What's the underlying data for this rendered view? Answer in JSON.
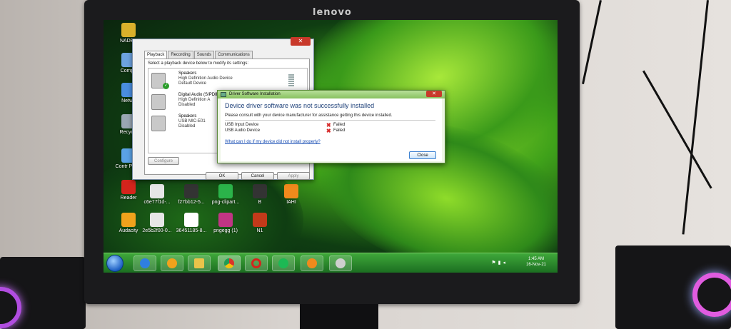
{
  "monitor": {
    "brand": "lenovo"
  },
  "desktop": {
    "icons": [
      {
        "label": "NADEE",
        "color": "#d9b12b"
      },
      {
        "label": "Compu",
        "color": "#6da3e0"
      },
      {
        "label": "Netwo",
        "color": "#4a8ee0"
      },
      {
        "label": "Recycle",
        "color": "#9aa7b3"
      },
      {
        "label": "Contr Panel",
        "color": "#5aa2e6"
      },
      {
        "label": "Reader",
        "color": "#d4241c"
      },
      {
        "label": "Audacity",
        "color": "#f0a21c"
      },
      {
        "label": "c6e77f1d-...",
        "color": "#e6e6e6"
      },
      {
        "label": "2e5b2f00-0...",
        "color": "#e6e6e6"
      },
      {
        "label": "f27bb12-5...",
        "color": "#333333"
      },
      {
        "label": "36451185-8...",
        "color": "#ffffff"
      },
      {
        "label": "png-clipart...",
        "color": "#2bb34a"
      },
      {
        "label": "pngegg (1)",
        "color": "#c13584"
      },
      {
        "label": "B",
        "color": "#333333"
      },
      {
        "label": "N1",
        "color": "#c23a1a"
      },
      {
        "label": "IAHI",
        "color": "#f08a1c"
      }
    ]
  },
  "sound_dialog": {
    "tabs": [
      "Playback",
      "Recording",
      "Sounds",
      "Communications"
    ],
    "instruction": "Select a playback device below to modify its settings:",
    "devices": [
      {
        "name": "Speakers",
        "line1": "High Definition Audio Device",
        "line2": "Default Device"
      },
      {
        "name": "Digital Audio (S/PDIF)",
        "line1": "High Definition A",
        "line2": "Disabled"
      },
      {
        "name": "Speakers",
        "line1": "USB MIC-E01",
        "line2": "Disabled"
      }
    ],
    "configure_label": "Configure",
    "ok_label": "OK",
    "cancel_label": "Cancel",
    "apply_label": "Apply"
  },
  "driver_dialog": {
    "title": "Driver Software Installation",
    "heading": "Device driver software was not successfully installed",
    "message": "Please consult with your device manufacturer for assistance getting this device installed.",
    "rows": [
      {
        "device": "USB Input Device",
        "status": "Failed"
      },
      {
        "device": "USB Audio Device",
        "status": "Failed"
      }
    ],
    "help_link": "What can I do if my device did not install properly?",
    "close_label": "Close"
  },
  "taskbar": {
    "apps": [
      {
        "name": "ie-icon",
        "color": "#2f7fe0"
      },
      {
        "name": "media-player-icon",
        "color": "#f0a21c"
      },
      {
        "name": "explorer-icon",
        "color": "#e9c34a"
      },
      {
        "name": "chrome-icon",
        "color": "#d9352b"
      },
      {
        "name": "opera-icon",
        "color": "#d4241c"
      },
      {
        "name": "spotify-icon",
        "color": "#1db954"
      },
      {
        "name": "fl-studio-icon",
        "color": "#f08a1c"
      },
      {
        "name": "usb-device-icon",
        "color": "#cfcfcf"
      }
    ],
    "time": "1:45 AM",
    "date": "16-Nov-21"
  }
}
